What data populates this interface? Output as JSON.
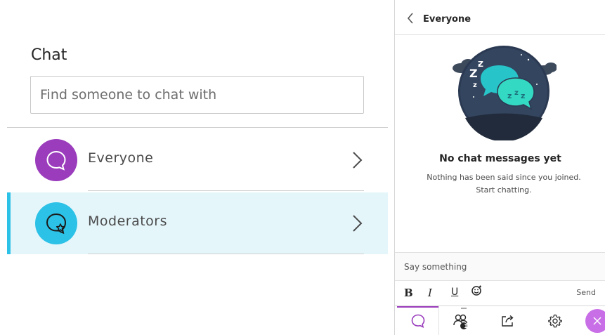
{
  "chat_list": {
    "title": "Chat",
    "search_placeholder": "Find someone to chat with",
    "items": [
      {
        "label": "Everyone",
        "icon": "chat-bubble-icon",
        "color": "#9a3cbc",
        "active": false
      },
      {
        "label": "Moderators",
        "icon": "chat-bubble-star-icon",
        "color": "#2cc1e6",
        "active": true
      }
    ]
  },
  "conversation": {
    "title": "Everyone",
    "empty_title": "No chat messages yet",
    "empty_line1": "Nothing has been said since you joined.",
    "empty_line2": "Start chatting.",
    "input_placeholder": "Say something",
    "format": {
      "bold": "B",
      "italic": "I",
      "underline": "U"
    },
    "send_label": "Send"
  },
  "bottom_nav": {
    "items": [
      "chat-icon",
      "participants-icon",
      "share-icon",
      "settings-icon",
      "close-icon"
    ],
    "participants_badge": "1"
  },
  "colors": {
    "accent_purple": "#9a3cbc",
    "accent_cyan": "#2cc1e6",
    "active_row_bg": "#e5f6fb",
    "close_button": "#c86ee6"
  }
}
